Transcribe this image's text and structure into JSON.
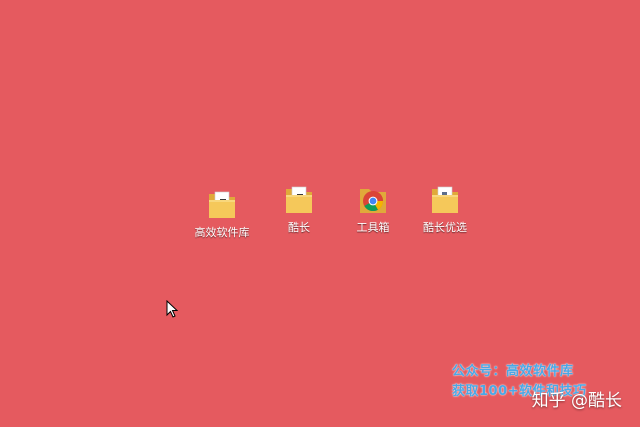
{
  "desktop": {
    "background_color": "#e55a5f",
    "icons": [
      {
        "label": "高效软件库",
        "icon": "folder-doc-icon"
      },
      {
        "label": "酷长",
        "icon": "folder-doc-icon"
      },
      {
        "label": "工具箱",
        "icon": "chrome-icon"
      },
      {
        "label": "酷长优选",
        "icon": "folder-doc-icon"
      }
    ]
  },
  "watermark": {
    "line1": "公众号：高效软件库",
    "line2": "获取100+软件和技巧"
  },
  "credit": {
    "text": "知乎 @酷长"
  },
  "colors": {
    "folder": "#f5c85a",
    "folder_dark": "#e0a93a",
    "watermark_text": "#4aa7e6"
  }
}
